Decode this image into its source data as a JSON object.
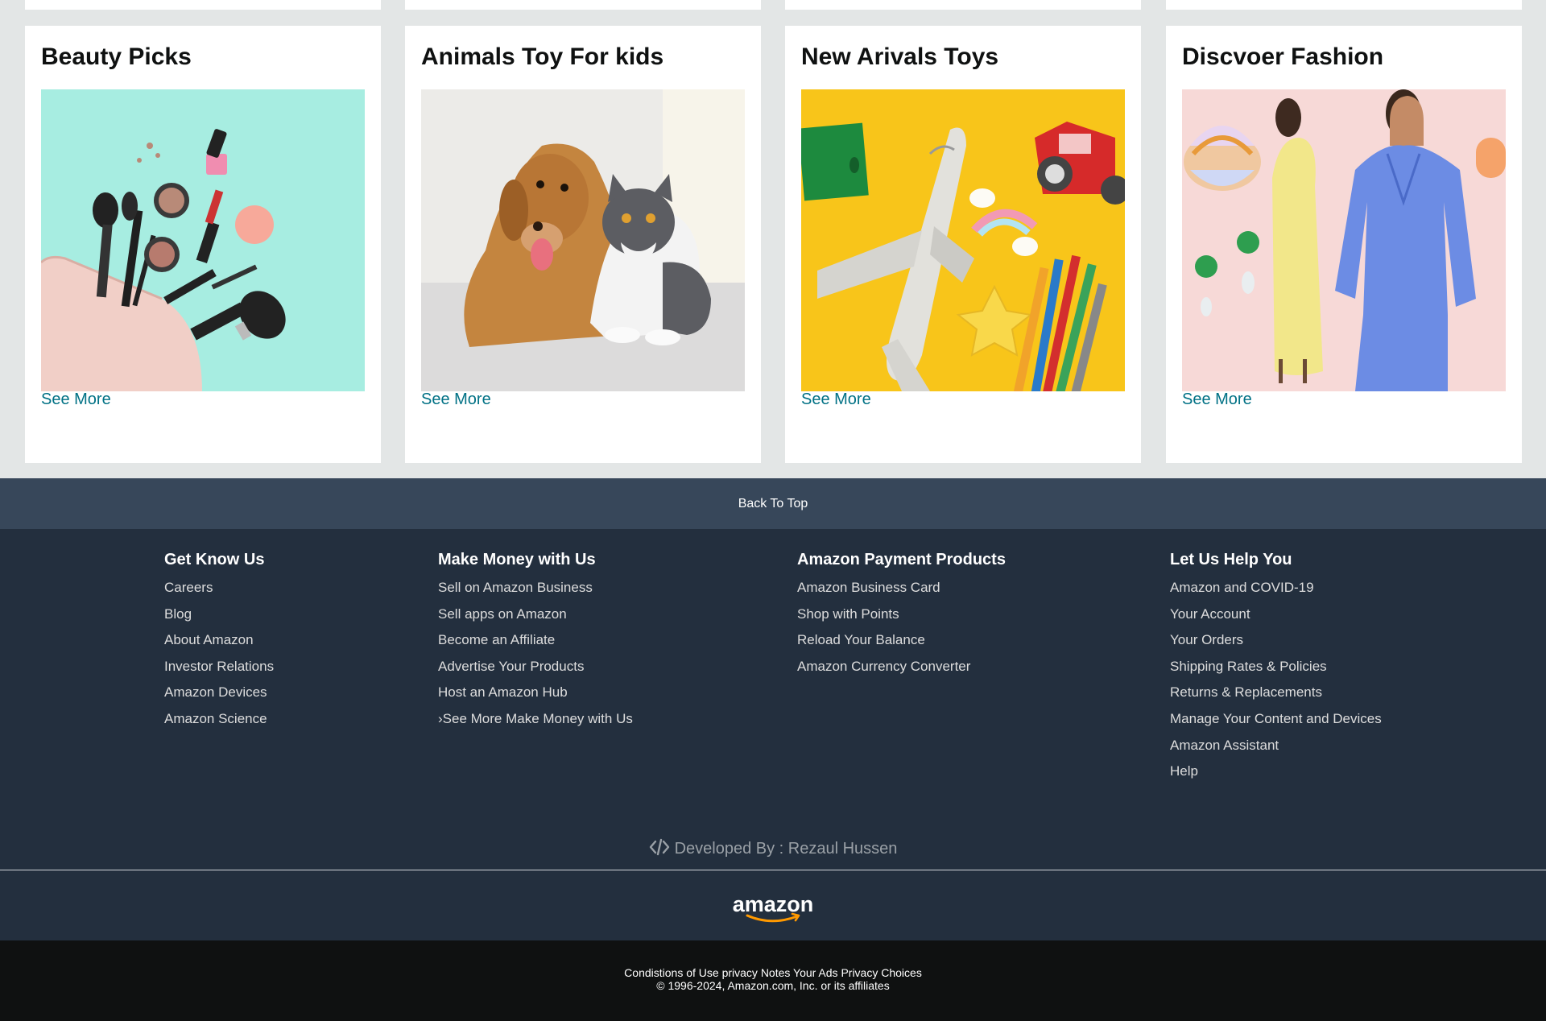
{
  "cards": [
    {
      "title": "Beauty Picks",
      "link": "See More"
    },
    {
      "title": "Animals Toy For kids",
      "link": "See More"
    },
    {
      "title": "New Arivals Toys",
      "link": "See More"
    },
    {
      "title": "Discvoer Fashion",
      "link": "See More"
    }
  ],
  "back_to_top": "Back To Top",
  "footer": {
    "columns": [
      {
        "heading": "Get Know Us",
        "items": [
          "Careers",
          "Blog",
          "About Amazon",
          "Investor Relations",
          "Amazon Devices",
          "Amazon Science"
        ]
      },
      {
        "heading": "Make Money with Us",
        "items": [
          "Sell on Amazon Business",
          "Sell apps on Amazon",
          "Become an Affiliate",
          "Advertise Your Products",
          "Host an Amazon Hub",
          "›See More Make Money with Us"
        ]
      },
      {
        "heading": "Amazon Payment Products",
        "items": [
          "Amazon Business Card",
          "Shop with Points",
          "Reload Your Balance",
          "Amazon Currency Converter"
        ]
      },
      {
        "heading": "Let Us Help You",
        "items": [
          "Amazon and COVID-19",
          "Your Account",
          "Your Orders",
          "Shipping Rates & Policies",
          "Returns & Replacements",
          "Manage Your Content and Devices",
          "Amazon Assistant",
          "Help"
        ]
      }
    ],
    "developed_by": "Developed By : Rezaul Hussen",
    "logo_text": "amazon"
  },
  "bottom": {
    "links": [
      "Condistions of Use",
      "privacy Notes",
      "Your Ads Privacy Choices"
    ],
    "copyright": "© 1996-2024, Amazon.com, Inc. or its affiliates"
  },
  "icons": {
    "developed_by": "code-icon",
    "logo": "amazon-logo"
  },
  "colors": {
    "link": "#007185",
    "footer_bg": "#232f3e",
    "back_to_top_bg": "#37475a",
    "bottom_bg": "#0f1111",
    "page_bg": "#e3e6e6",
    "logo_smile": "#ff9900"
  }
}
